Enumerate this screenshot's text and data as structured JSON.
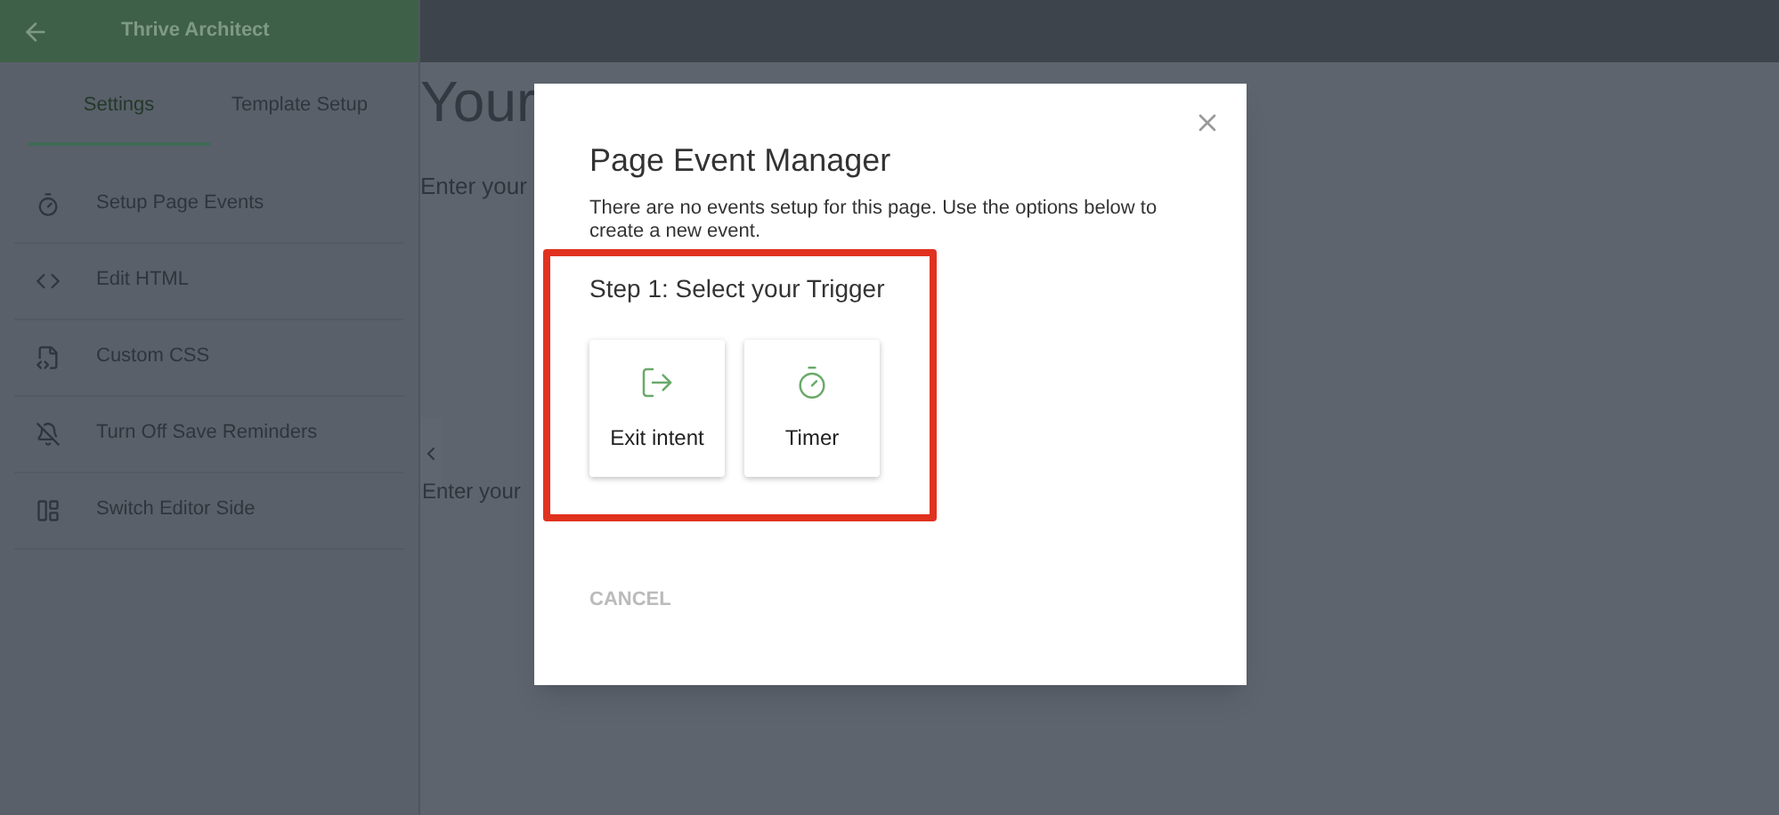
{
  "header": {
    "title": "Thrive Architect"
  },
  "tabs": [
    {
      "label": "Settings",
      "selected": true
    },
    {
      "label": "Template Setup",
      "selected": false
    }
  ],
  "menu": [
    "Setup Page Events",
    "Edit HTML",
    "Custom CSS",
    "Turn Off Save Reminders",
    "Switch Editor Side"
  ],
  "canvas": {
    "heading": "Your",
    "lines": [
      "Enter your",
      "Enter your"
    ]
  },
  "dialog": {
    "title": "Page Event Manager",
    "description": "There are no events setup for this page. Use the options below to create a new event.",
    "step": "Step 1: Select your Trigger",
    "triggers": [
      "Exit intent",
      "Timer"
    ],
    "cancel": {
      "label": "CANCEL",
      "disabled": true
    }
  }
}
